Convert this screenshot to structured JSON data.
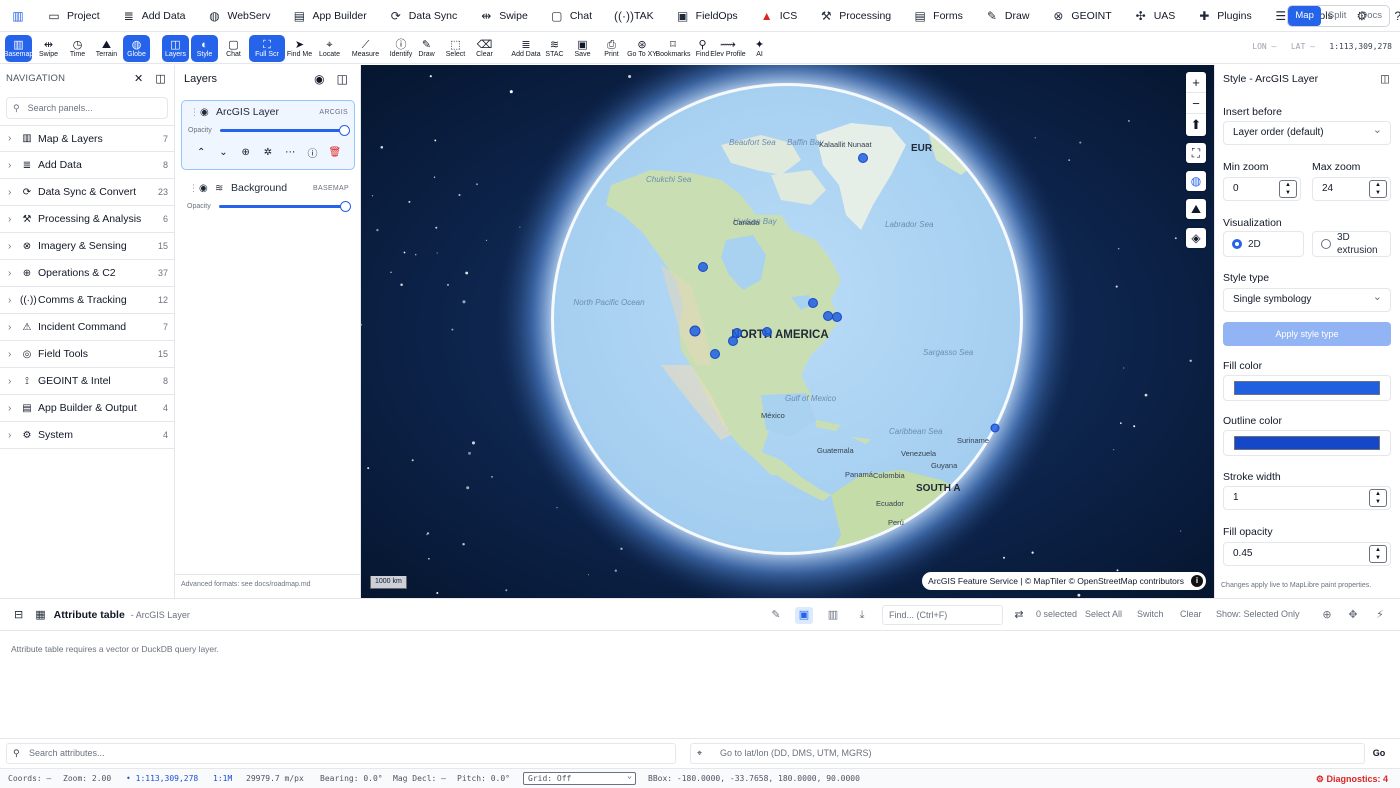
{
  "colors": {
    "accent": "#2563eb",
    "fill": "#1f5fe0",
    "outline": "#1747c9",
    "danger": "#dc2626"
  },
  "menu": [
    {
      "label": "",
      "icon": "map-book-icon"
    },
    {
      "label": "Project",
      "icon": "folder-icon"
    },
    {
      "label": "Add Data",
      "icon": "database-icon"
    },
    {
      "label": "WebServ",
      "icon": "globe-icon"
    },
    {
      "label": "App Builder",
      "icon": "document-icon"
    },
    {
      "label": "Data Sync",
      "icon": "sync-icon"
    },
    {
      "label": "Swipe",
      "icon": "swipe-icon"
    },
    {
      "label": "Chat",
      "icon": "chat-icon"
    },
    {
      "label": "TAK",
      "icon": "radio-icon"
    },
    {
      "label": "FieldOps",
      "icon": "clipboard-icon"
    },
    {
      "label": "ICS",
      "icon": "alert-icon"
    },
    {
      "label": "Processing",
      "icon": "wrench-icon"
    },
    {
      "label": "Forms",
      "icon": "form-icon"
    },
    {
      "label": "Draw",
      "icon": "draw-icon"
    },
    {
      "label": "GEOINT",
      "icon": "satellite-icon"
    },
    {
      "label": "UAS",
      "icon": "drone-icon"
    },
    {
      "label": "Plugins",
      "icon": "puzzle-icon"
    },
    {
      "label": "Controls",
      "icon": "sliders-icon"
    },
    {
      "label": "",
      "icon": "gear-icon"
    },
    {
      "label": "Help",
      "icon": "help-icon"
    },
    {
      "label": "",
      "icon": "moon-icon"
    }
  ],
  "mode_toggle": {
    "map": "Map",
    "split": "Split",
    "docs": "Docs",
    "active": "Map"
  },
  "toolbar": [
    {
      "label": "Basemap",
      "icon": "basemap-icon",
      "active": true
    },
    {
      "label": "Swipe",
      "icon": "swipe-icon",
      "active": false
    },
    {
      "label": "Time",
      "icon": "clock-icon",
      "active": false
    },
    {
      "label": "Terrain",
      "icon": "mountain-icon",
      "active": false
    },
    {
      "label": "Globe",
      "icon": "globe-icon",
      "active": true
    },
    {
      "label": "Layers",
      "icon": "layers-icon",
      "active": true
    },
    {
      "label": "Style",
      "icon": "palette-icon",
      "active": true
    },
    {
      "label": "Chat",
      "icon": "chat-icon",
      "active": false
    },
    {
      "label": "Full Scr",
      "icon": "fullscreen-icon",
      "active": true
    },
    {
      "label": "Find Me",
      "icon": "locate-arrow-icon",
      "active": false
    },
    {
      "label": "Locate",
      "icon": "crosshair-icon",
      "active": false
    },
    {
      "label": "Measure",
      "icon": "ruler-icon",
      "active": false
    },
    {
      "label": "Identify",
      "icon": "info-icon",
      "active": false
    },
    {
      "label": "Draw",
      "icon": "pencil-icon",
      "active": false
    },
    {
      "label": "Select",
      "icon": "select-box-icon",
      "active": false
    },
    {
      "label": "Clear",
      "icon": "eraser-icon",
      "active": false
    },
    {
      "label": "Add Data",
      "icon": "database-icon",
      "active": false
    },
    {
      "label": "STAC",
      "icon": "stac-icon",
      "active": false
    },
    {
      "label": "Save",
      "icon": "save-icon",
      "active": false
    },
    {
      "label": "Print",
      "icon": "print-icon",
      "active": false
    },
    {
      "label": "Go To XY",
      "icon": "goto-icon",
      "active": false
    },
    {
      "label": "Bookmarks",
      "icon": "bookmark-icon",
      "active": false
    },
    {
      "label": "Find",
      "icon": "search-icon",
      "active": false
    },
    {
      "label": "Elev Profile",
      "icon": "profile-icon",
      "active": false
    },
    {
      "label": "AI",
      "icon": "sparkle-icon",
      "active": false
    }
  ],
  "readout": {
    "lon_label": "LON",
    "lon": "—",
    "lat_label": "LAT",
    "lat": "—",
    "scale": "1:113,309,278"
  },
  "nav": {
    "title": "NAVIGATION",
    "search_placeholder": "Search panels...",
    "categories": [
      {
        "label": "Map & Layers",
        "count": "7",
        "icon": "map-icon"
      },
      {
        "label": "Add Data",
        "count": "8",
        "icon": "database-icon"
      },
      {
        "label": "Data Sync & Convert",
        "count": "23",
        "icon": "sync-icon"
      },
      {
        "label": "Processing & Analysis",
        "count": "6",
        "icon": "wrench-icon"
      },
      {
        "label": "Imagery & Sensing",
        "count": "15",
        "icon": "satellite-icon"
      },
      {
        "label": "Operations & C2",
        "count": "37",
        "icon": "target-icon"
      },
      {
        "label": "Comms & Tracking",
        "count": "12",
        "icon": "radio-icon"
      },
      {
        "label": "Incident Command",
        "count": "7",
        "icon": "warning-icon"
      },
      {
        "label": "Field Tools",
        "count": "15",
        "icon": "compass-icon"
      },
      {
        "label": "GEOINT & Intel",
        "count": "8",
        "icon": "satellite-dish-icon"
      },
      {
        "label": "App Builder & Output",
        "count": "4",
        "icon": "document-icon"
      },
      {
        "label": "System",
        "count": "4",
        "icon": "gear-icon"
      }
    ]
  },
  "layers": {
    "title": "Layers",
    "items": [
      {
        "name": "ArcGIS Layer",
        "tag": "ARCGIS",
        "opacity_label": "Opacity",
        "opacity": 1.0
      },
      {
        "name": "Background",
        "tag": "BASEMAP",
        "opacity_label": "Opacity",
        "opacity": 1.0
      }
    ],
    "footnote": "Advanced formats: see docs/roadmap.md"
  },
  "map": {
    "labels": {
      "north_america": "NORTH AMERICA",
      "south_america": "SOUTH A",
      "eur": "EUR",
      "north_pacific": "North Pacific Ocean",
      "beaufort": "Beaufort Sea",
      "baffin": "Baffin Bay",
      "labrador": "Labrador Sea",
      "sargasso": "Sargasso Sea",
      "caribbean": "Caribbean Sea",
      "gulf": "Gulf of Mexico",
      "canada": "Canada",
      "mexico": "México",
      "guatemala": "Guatemala",
      "venezuela": "Venezuela",
      "colombia": "Colombia",
      "panama": "Panamá",
      "guyana": "Guyana",
      "suriname": "Suriname",
      "ecuador": "Ecuador",
      "peru": "Perú",
      "kalaallit": "Kalaallit Nunaat",
      "chukchi": "Chukchi Sea",
      "hudson": "Hudson Bay"
    },
    "scale": "1000 km",
    "attribution": "ArcGIS Feature Service | © MapTiler © OpenStreetMap contributors",
    "controls": [
      "zoom-in-icon",
      "zoom-out-icon",
      "compass-reset-icon",
      "fullscreen-icon",
      "globe-icon",
      "terrain-icon",
      "layers-icon"
    ]
  },
  "style_panel": {
    "title": "Style - ArcGIS Layer",
    "insert_before_label": "Insert before",
    "insert_before": "Layer order (default)",
    "min_zoom_label": "Min zoom",
    "min_zoom": "0",
    "max_zoom_label": "Max zoom",
    "max_zoom": "24",
    "visualization_label": "Visualization",
    "vis_2d": "2D",
    "vis_3d": "3D extrusion",
    "style_type_label": "Style type",
    "style_type": "Single symbology",
    "apply": "Apply style type",
    "fill_color_label": "Fill color",
    "outline_color_label": "Outline color",
    "stroke_width_label": "Stroke width",
    "stroke_width": "1",
    "fill_opacity_label": "Fill opacity",
    "fill_opacity": "0.45",
    "note": "Changes apply live to MapLibre paint properties."
  },
  "attribute_table": {
    "title": "Attribute table",
    "layer": "- ArcGIS Layer",
    "find_placeholder": "Find... (Ctrl+F)",
    "selected": "0 selected",
    "select_all": "Select All",
    "switch": "Switch",
    "clear": "Clear",
    "show": "Show: Selected Only",
    "message": "Attribute table requires a vector or DuckDB query layer."
  },
  "search": {
    "attr_placeholder": "Search attributes...",
    "goto_placeholder": "Go to lat/lon (DD, DMS, UTM, MGRS)",
    "go": "Go"
  },
  "status": {
    "coords": "Coords: —",
    "zoom": "Zoom: 2.00",
    "scale": "• 1:113,309,278",
    "scale_short": "1:1M",
    "resolution": "29979.7 m/px",
    "bearing": "Bearing: 0.0°",
    "mag": "Mag Decl: —",
    "pitch": "Pitch: 0.0°",
    "grid": "Grid: Off",
    "bbox": "BBox: -180.0000, -33.7658, 180.0000, 90.0000",
    "diagnostics": "⚙ Diagnostics: 4"
  }
}
